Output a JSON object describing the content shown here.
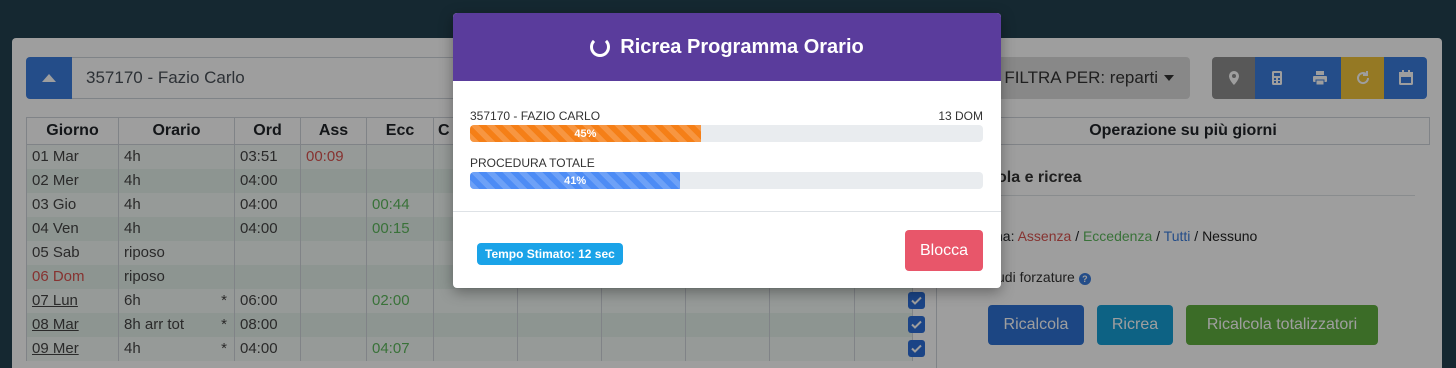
{
  "header": {
    "employee": "357170 - Fazio Carlo",
    "filter_label": "FILTRA PER: reparti",
    "tools": [
      "map-pin-icon",
      "calculator-icon",
      "printer-icon",
      "refresh-icon",
      "calendar-icon"
    ]
  },
  "table": {
    "columns": [
      "Giorno",
      "Orario",
      "Ord",
      "Ass",
      "Ecc",
      "C"
    ],
    "rows": [
      {
        "day": "01 Mar",
        "orario": "4h",
        "star": "",
        "ord": "03:51",
        "ass": "00:09",
        "ecc": ""
      },
      {
        "day": "02 Mer",
        "orario": "4h",
        "star": "",
        "ord": "04:00",
        "ass": "",
        "ecc": ""
      },
      {
        "day": "03 Gio",
        "orario": "4h",
        "star": "",
        "ord": "04:00",
        "ass": "",
        "ecc": "00:44"
      },
      {
        "day": "04 Ven",
        "orario": "4h",
        "star": "",
        "ord": "04:00",
        "ass": "",
        "ecc": "00:15"
      },
      {
        "day": "05 Sab",
        "orario": "riposo",
        "star": "",
        "ord": "",
        "ass": "",
        "ecc": ""
      },
      {
        "day": "06 Dom",
        "orario": "riposo",
        "star": "",
        "ord": "",
        "ass": "",
        "ecc": ""
      },
      {
        "day": "07 Lun",
        "orario": "6h",
        "star": "*",
        "ord": "06:00",
        "ass": "",
        "ecc": "02:00"
      },
      {
        "day": "08 Mar",
        "orario": "8h arr tot",
        "star": "*",
        "ord": "08:00",
        "ass": "",
        "ecc": ""
      },
      {
        "day": "09 Mer",
        "orario": "4h",
        "star": "*",
        "ord": "04:00",
        "ass": "",
        "ecc": "04:07"
      }
    ]
  },
  "side": {
    "heading": "Operazione su più giorni",
    "title": "ola e ricrea",
    "select_prefix": "na:",
    "select_assenza": "Assenza",
    "select_eccedenza": "Eccedenza",
    "select_tutti": "Tutti",
    "select_nessuno": "Nessuno",
    "sep": "/",
    "forzature": "udi forzature",
    "btn_ricalcola": "Ricalcola",
    "btn_ricrea": "Ricrea",
    "btn_totalizzatori": "Ricalcola totalizzatori"
  },
  "modal": {
    "title": "Ricrea Programma Orario",
    "employee_label": "357170 - FAZIO CARLO",
    "day_label": "13 DOM",
    "employee_progress": 45,
    "employee_progress_text": "45%",
    "total_label": "PROCEDURA TOTALE",
    "total_progress": 41,
    "total_progress_text": "41%",
    "eta": "Tempo Stimato: 12 sec",
    "stop_label": "Blocca"
  },
  "colors": {
    "modal_header": "#5a3c9c",
    "employee_bar": "#f57f17",
    "total_bar": "#4d8cf5",
    "stop_button": "#e8566a",
    "eta_badge": "#1aa3e8"
  }
}
